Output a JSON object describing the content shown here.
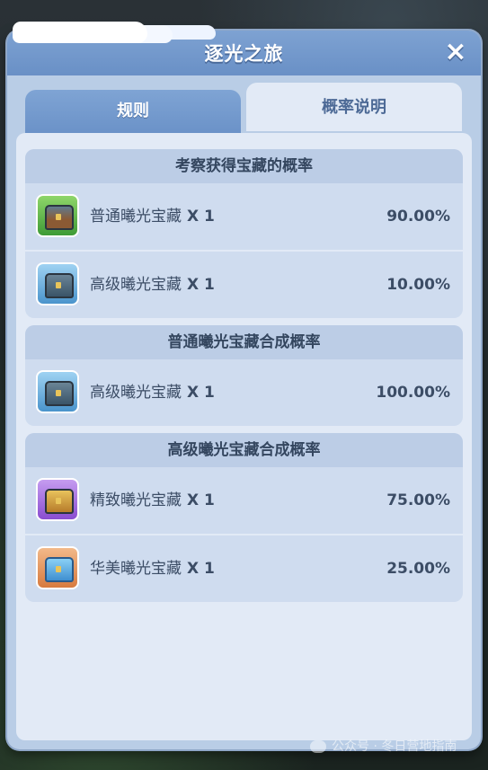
{
  "dialog": {
    "title": "逐光之旅",
    "close_icon": "×"
  },
  "tabs": [
    {
      "label": "规则",
      "active": false
    },
    {
      "label": "概率说明",
      "active": true
    }
  ],
  "sections": [
    {
      "title": "考察获得宝藏的概率",
      "rows": [
        {
          "name": "普通曦光宝藏",
          "qty": "X 1",
          "pct": "90.00%",
          "icon": "green-chest-icon"
        },
        {
          "name": "高级曦光宝藏",
          "qty": "X 1",
          "pct": "10.00%",
          "icon": "blue-chest-icon"
        }
      ]
    },
    {
      "title": "普通曦光宝藏合成概率",
      "rows": [
        {
          "name": "高级曦光宝藏",
          "qty": "X 1",
          "pct": "100.00%",
          "icon": "blue-chest-icon"
        }
      ]
    },
    {
      "title": "高级曦光宝藏合成概率",
      "rows": [
        {
          "name": "精致曦光宝藏",
          "qty": "X 1",
          "pct": "75.00%",
          "icon": "purple-chest-icon"
        },
        {
          "name": "华美曦光宝藏",
          "qty": "X 1",
          "pct": "25.00%",
          "icon": "orange-chest-icon"
        }
      ]
    }
  ],
  "watermark": "公众号 · 冬日营地指南",
  "colors": {
    "header": "#6990c6",
    "panel": "#e2eaf6",
    "section": "#cfdcef"
  }
}
